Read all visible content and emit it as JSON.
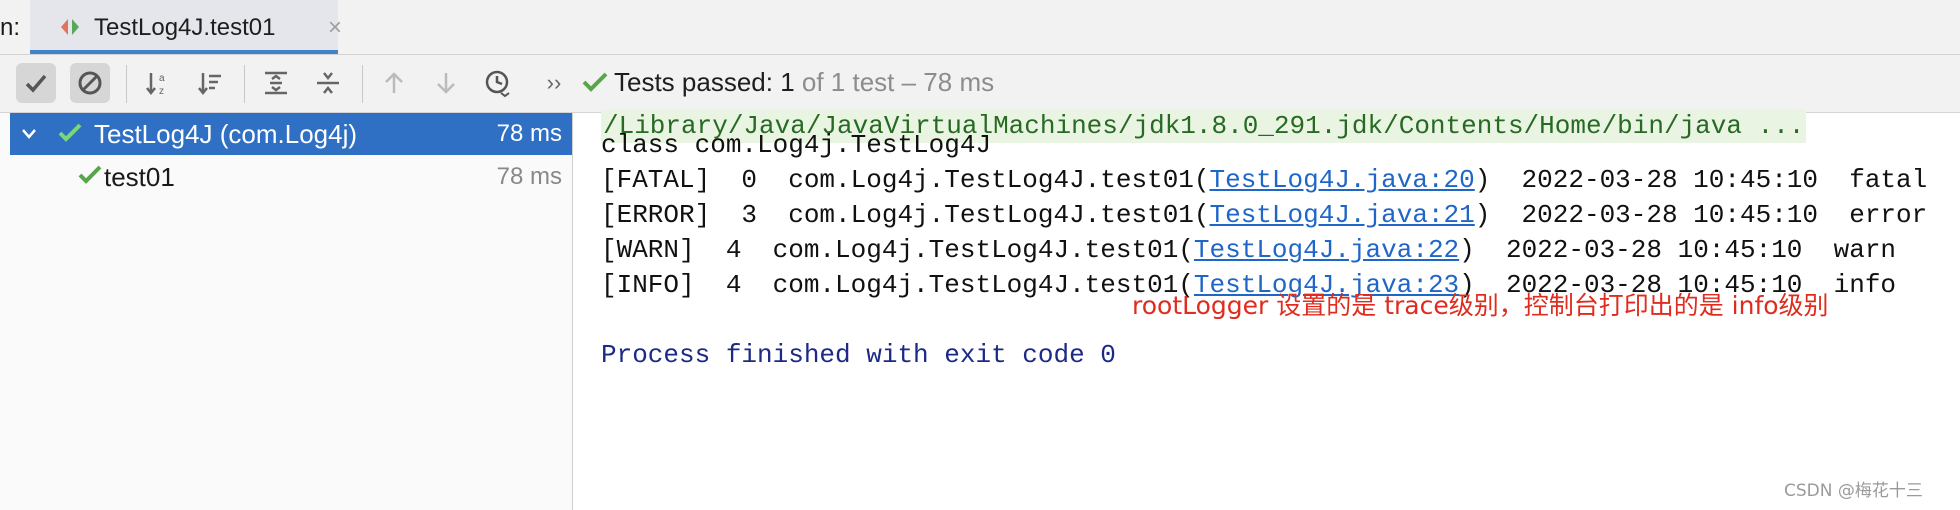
{
  "tab_bar": {
    "run_label": "n:",
    "tab_title": "TestLog4J.test01",
    "close_glyph": "×"
  },
  "toolbar": {
    "buttons": [
      "show-passed-icon",
      "show-ignored-icon",
      "sort-alphabetically-icon",
      "sort-by-duration-icon",
      "expand-all-icon",
      "collapse-all-icon",
      "previous-failed-icon",
      "next-failed-icon",
      "test-history-icon",
      "more-icon"
    ],
    "more_glyph": "››",
    "status_prefix": "Tests passed: 1",
    "status_suffix": "of 1 test – 78 ms",
    "accent_check_color": "#57a64a"
  },
  "tree": {
    "root_label": "TestLog4J (com.Log4j)",
    "root_time": "78 ms",
    "child_label": "test01",
    "child_time": "78 ms",
    "selected_color": "#2f6fc4"
  },
  "console": {
    "cmd": "/Library/Java/JavaVirtualMachines/jdk1.8.0_291.jdk/Contents/Home/bin/java ...",
    "class_line": "class com.Log4j.TestLog4J",
    "logs": [
      {
        "pre": "[FATAL]  0  com.Log4j.TestLog4J.test01(",
        "link": "TestLog4J.java:20",
        "post": ")  2022-03-28 10:45:10  fatal"
      },
      {
        "pre": "[ERROR]  3  com.Log4j.TestLog4J.test01(",
        "link": "TestLog4J.java:21",
        "post": ")  2022-03-28 10:45:10  error"
      },
      {
        "pre": "[WARN]  4  com.Log4j.TestLog4J.test01(",
        "link": "TestLog4J.java:22",
        "post": ")  2022-03-28 10:45:10  warn"
      },
      {
        "pre": "[INFO]  4  com.Log4j.TestLog4J.test01(",
        "link": "TestLog4J.java:23",
        "post": ")  2022-03-28 10:45:10  info"
      }
    ],
    "finished": "Process finished with exit code 0",
    "note": "rootLogger 设置的是 trace级别，控制台打印出的是 info级别"
  },
  "watermark": "CSDN @梅花十三"
}
